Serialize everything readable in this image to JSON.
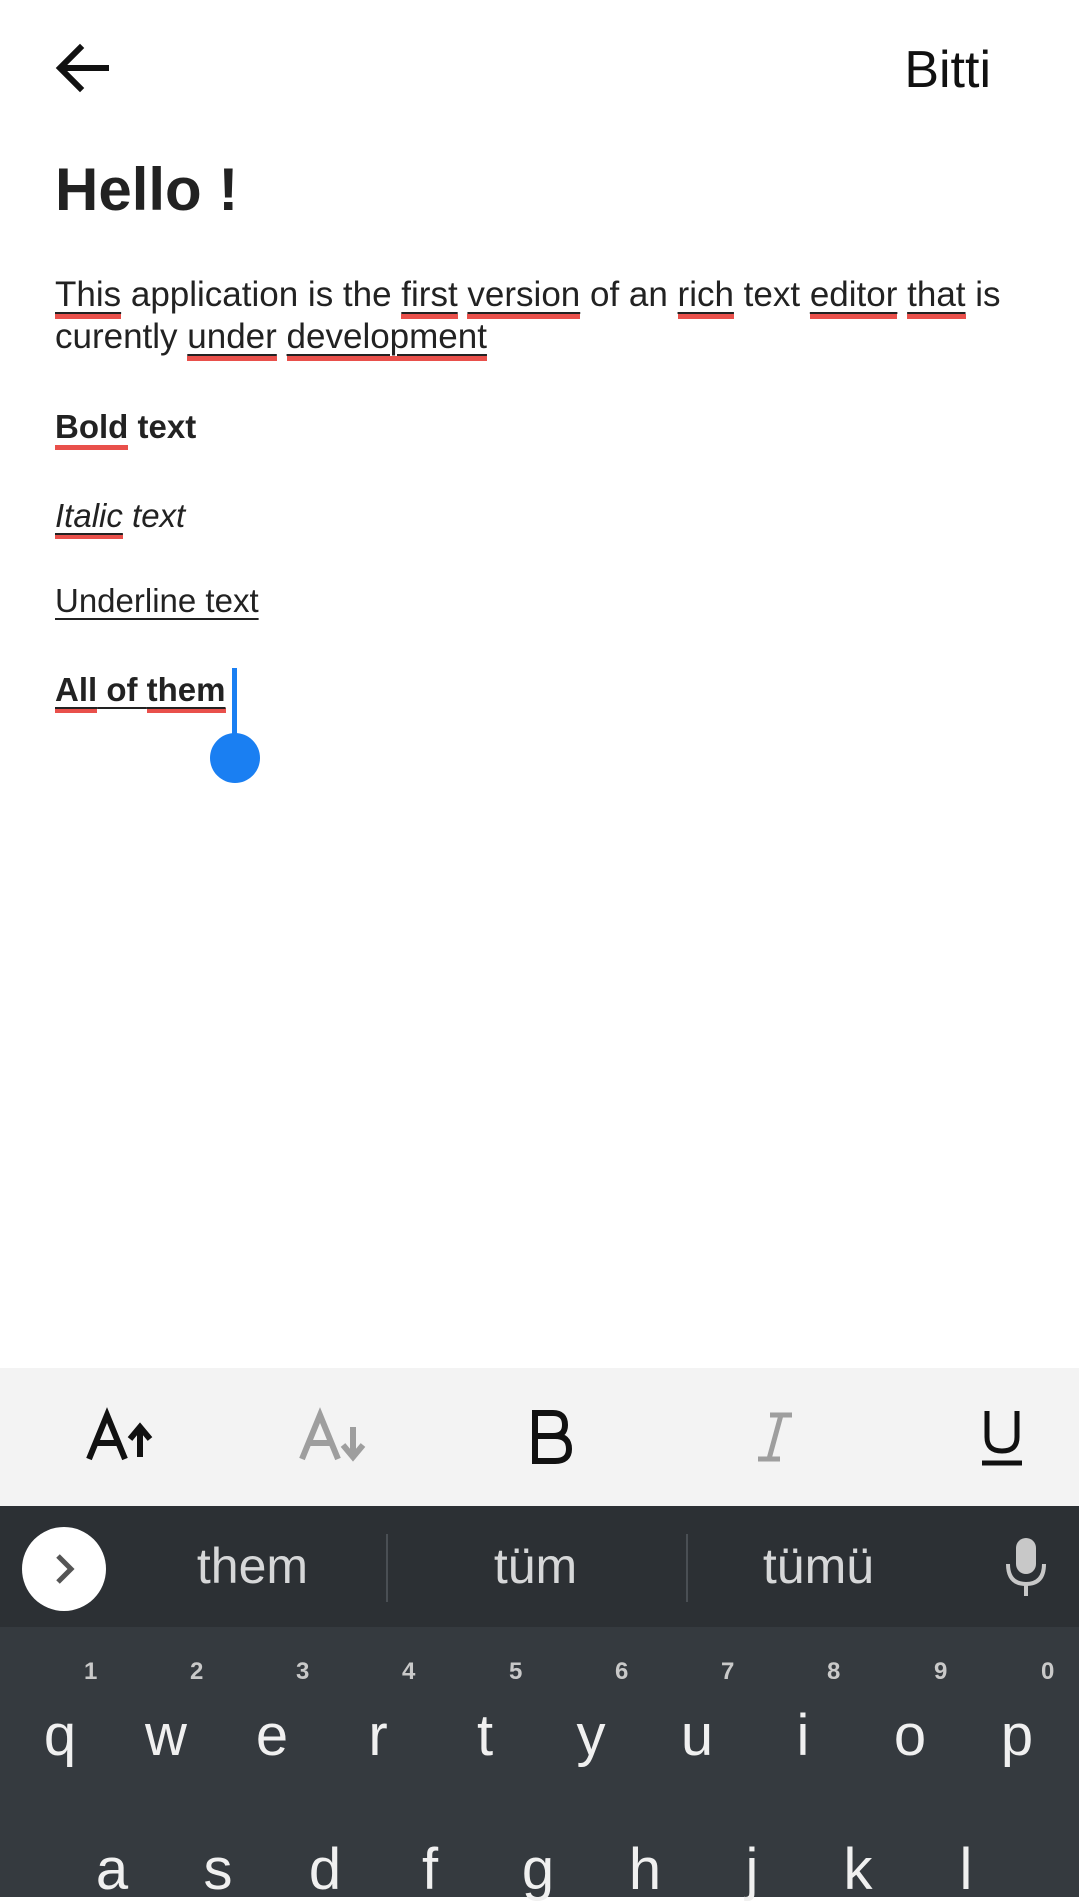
{
  "toolbar": {
    "done_label": "Bitti"
  },
  "editor": {
    "heading": "Hello !",
    "paragraph": {
      "w1": "This",
      "t1": " application is the ",
      "w2": "first",
      "t2": " ",
      "w3": "version",
      "t3": " of an ",
      "w4": "rich",
      "t4": " text ",
      "w5": "editor",
      "t5": " ",
      "w6": "that",
      "t6": " is curently ",
      "w7": "under",
      "t7": " ",
      "w8": "development"
    },
    "bold": {
      "w1": "Bold",
      "rest": " text"
    },
    "italic": {
      "w1": "Italic",
      "rest": " text"
    },
    "underline": "Underline text",
    "all": {
      "w1": "All",
      "mid": " of ",
      "w2": "them"
    }
  },
  "format_toolbar": {
    "items": [
      "increase-font-size",
      "decrease-font-size",
      "bold",
      "italic",
      "underline"
    ]
  },
  "keyboard": {
    "suggestions": [
      "them",
      "tüm",
      "tümü"
    ],
    "row1": [
      "q",
      "w",
      "e",
      "r",
      "t",
      "y",
      "u",
      "i",
      "o",
      "p"
    ],
    "row1_hints": [
      "1",
      "2",
      "3",
      "4",
      "5",
      "6",
      "7",
      "8",
      "9",
      "0"
    ],
    "row2": [
      "a",
      "s",
      "d",
      "f",
      "g",
      "h",
      "j",
      "k",
      "l"
    ]
  },
  "colors": {
    "accent": "#1a7ff2",
    "spellcheck": "#e9504b",
    "keyboard_bg": "#353a3f"
  }
}
